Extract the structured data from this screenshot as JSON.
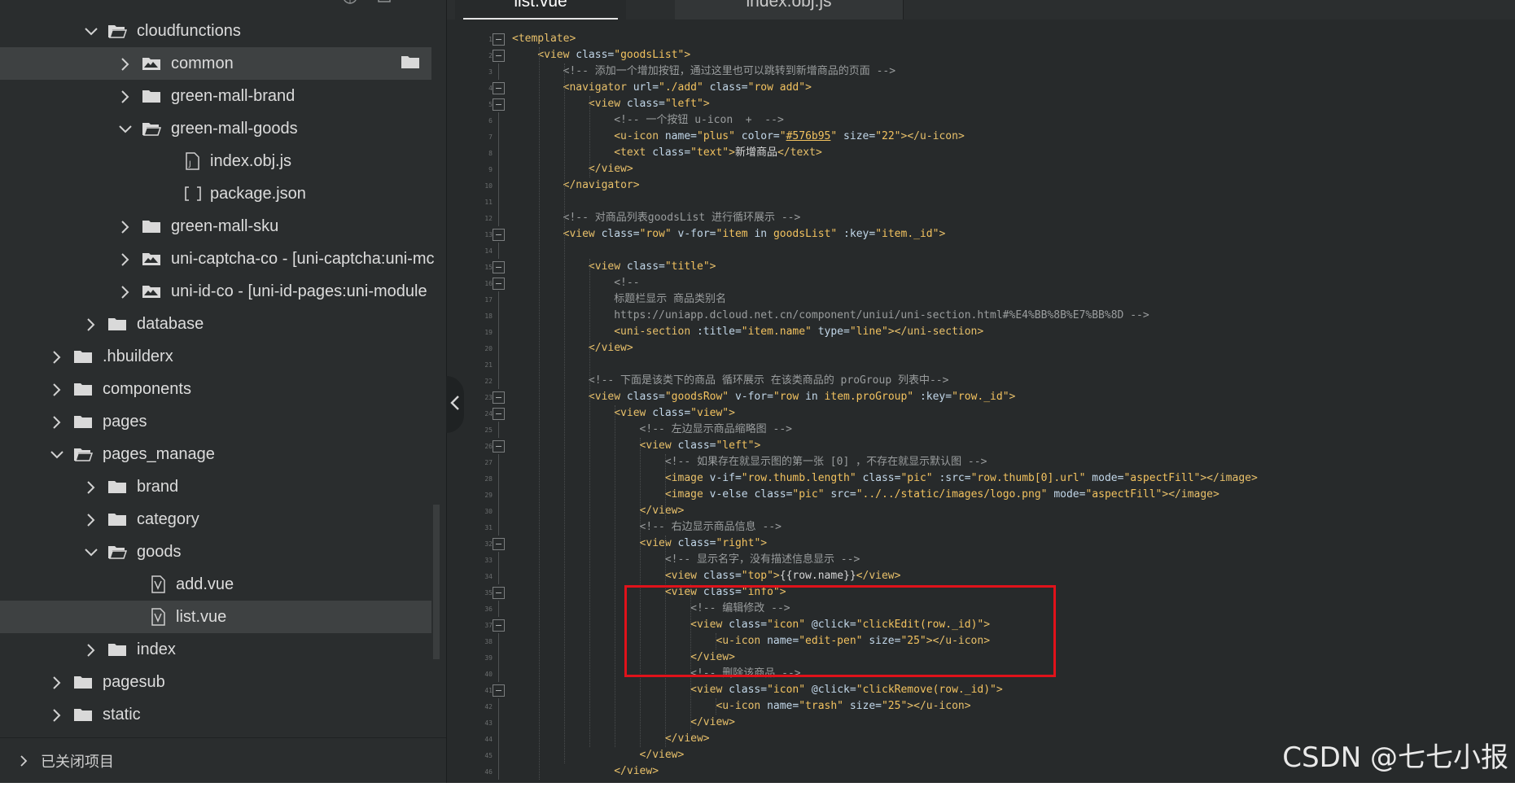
{
  "sidebar": {
    "items": [
      {
        "label": "cloudfunctions",
        "state": "open",
        "type": "folder-open"
      },
      {
        "label": "common",
        "state": "closed",
        "type": "folder-special",
        "selected": true
      },
      {
        "label": "green-mall-brand",
        "state": "closed",
        "type": "folder"
      },
      {
        "label": "green-mall-goods",
        "state": "open",
        "type": "folder-open"
      },
      {
        "label": "index.obj.js",
        "state": "none",
        "type": "js-file"
      },
      {
        "label": "package.json",
        "state": "none",
        "type": "json-file"
      },
      {
        "label": "green-mall-sku",
        "state": "closed",
        "type": "folder"
      },
      {
        "label": "uni-captcha-co - [uni-captcha:uni-mc",
        "state": "closed",
        "type": "folder-special"
      },
      {
        "label": "uni-id-co - [uni-id-pages:uni-module",
        "state": "closed",
        "type": "folder-special"
      },
      {
        "label": "database",
        "state": "closed",
        "type": "folder"
      },
      {
        "label": ".hbuilderx",
        "state": "closed",
        "type": "folder"
      },
      {
        "label": "components",
        "state": "closed",
        "type": "folder"
      },
      {
        "label": "pages",
        "state": "closed",
        "type": "folder"
      },
      {
        "label": "pages_manage",
        "state": "open",
        "type": "folder-open"
      },
      {
        "label": "brand",
        "state": "closed",
        "type": "folder"
      },
      {
        "label": "category",
        "state": "closed",
        "type": "folder"
      },
      {
        "label": "goods",
        "state": "open",
        "type": "folder-open"
      },
      {
        "label": "add.vue",
        "state": "none",
        "type": "vue-file"
      },
      {
        "label": "list.vue",
        "state": "none",
        "type": "vue-file",
        "selected": true
      },
      {
        "label": "index",
        "state": "closed",
        "type": "folder"
      },
      {
        "label": "pagesub",
        "state": "closed",
        "type": "folder"
      },
      {
        "label": "static",
        "state": "closed",
        "type": "folder"
      }
    ],
    "footer_label": "已关闭项目"
  },
  "tabs": [
    {
      "label": "list.vue",
      "active": true
    },
    {
      "label": "index.obj.js",
      "active": false
    }
  ],
  "editor": {
    "line_numbers": [
      "1",
      "2",
      "3",
      "4",
      "5",
      "6",
      "7",
      "8",
      "9",
      "10",
      "11",
      "12",
      "13",
      "14",
      "15",
      "16",
      "17",
      "18",
      "19",
      "20",
      "21",
      "22",
      "23",
      "24",
      "25",
      "26",
      "27",
      "28",
      "29",
      "30",
      "31",
      "32",
      "33",
      "34",
      "35",
      "36",
      "37",
      "38",
      "39",
      "40",
      "41",
      "42",
      "43",
      "44",
      "45",
      "46"
    ],
    "fold_lines": [
      1,
      2,
      4,
      5,
      13,
      15,
      16,
      23,
      24,
      26,
      32,
      35,
      37,
      41
    ],
    "lines": [
      [
        [
          "t",
          "<template>"
        ]
      ],
      [
        [
          "k",
          "    "
        ],
        [
          "t",
          "<view "
        ],
        [
          "a",
          "class="
        ],
        [
          "s",
          "\"goodsList\""
        ],
        [
          "t",
          ">"
        ]
      ],
      [
        [
          "k",
          "        "
        ],
        [
          "c",
          "<!-- 添加一个增加按钮，通过这里也可以跳转到新增商品的页面 -->"
        ]
      ],
      [
        [
          "k",
          "        "
        ],
        [
          "t",
          "<navigator "
        ],
        [
          "a",
          "url="
        ],
        [
          "s",
          "\"./add\" "
        ],
        [
          "a",
          "class="
        ],
        [
          "s",
          "\"row add\""
        ],
        [
          "t",
          ">"
        ]
      ],
      [
        [
          "k",
          "            "
        ],
        [
          "t",
          "<view "
        ],
        [
          "a",
          "class="
        ],
        [
          "s",
          "\"left\""
        ],
        [
          "t",
          ">"
        ]
      ],
      [
        [
          "k",
          "                "
        ],
        [
          "c",
          "<!-- 一个按钮 u-icon  +  -->"
        ]
      ],
      [
        [
          "k",
          "                "
        ],
        [
          "t",
          "<u-icon "
        ],
        [
          "a",
          "name="
        ],
        [
          "s",
          "\"plus\" "
        ],
        [
          "a",
          "color="
        ],
        [
          "s",
          "\""
        ],
        [
          "hex",
          "#576b95"
        ],
        [
          "s",
          "\" "
        ],
        [
          "a",
          "size="
        ],
        [
          "s",
          "\"22\""
        ],
        [
          "t",
          "></u-icon>"
        ]
      ],
      [
        [
          "k",
          "                "
        ],
        [
          "t",
          "<text "
        ],
        [
          "a",
          "class="
        ],
        [
          "s",
          "\"text\""
        ],
        [
          "t",
          ">"
        ],
        [
          "k",
          "新增商品"
        ],
        [
          "t",
          "</text>"
        ]
      ],
      [
        [
          "k",
          "            "
        ],
        [
          "t",
          "</view>"
        ]
      ],
      [
        [
          "k",
          "        "
        ],
        [
          "t",
          "</navigator>"
        ]
      ],
      [
        [
          "k",
          ""
        ]
      ],
      [
        [
          "k",
          "        "
        ],
        [
          "c",
          "<!-- 对商品列表goodsList 进行循环展示 -->"
        ]
      ],
      [
        [
          "k",
          "        "
        ],
        [
          "t",
          "<view "
        ],
        [
          "a",
          "class="
        ],
        [
          "s",
          "\"row\" "
        ],
        [
          "a",
          "v-for="
        ],
        [
          "s",
          "\"item "
        ],
        [
          "a",
          "in "
        ],
        [
          "s",
          "goodsList\" "
        ],
        [
          "a",
          ":key="
        ],
        [
          "s",
          "\"item._id\""
        ],
        [
          "t",
          ">"
        ]
      ],
      [
        [
          "k",
          ""
        ]
      ],
      [
        [
          "k",
          "            "
        ],
        [
          "t",
          "<view "
        ],
        [
          "a",
          "class="
        ],
        [
          "s",
          "\"title\""
        ],
        [
          "t",
          ">"
        ]
      ],
      [
        [
          "k",
          "                "
        ],
        [
          "c",
          "<!--"
        ]
      ],
      [
        [
          "k",
          "                "
        ],
        [
          "c",
          "标题栏显示 商品类别名"
        ]
      ],
      [
        [
          "k",
          "                "
        ],
        [
          "c",
          "https://uniapp.dcloud.net.cn/component/uniui/uni-section.html#%E4%BB%8B%E7%BB%8D -->"
        ]
      ],
      [
        [
          "k",
          "                "
        ],
        [
          "t",
          "<uni-section "
        ],
        [
          "a",
          ":title="
        ],
        [
          "s",
          "\"item.name\" "
        ],
        [
          "a",
          "type="
        ],
        [
          "s",
          "\"line\""
        ],
        [
          "t",
          "></uni-section>"
        ]
      ],
      [
        [
          "k",
          "            "
        ],
        [
          "t",
          "</view>"
        ]
      ],
      [
        [
          "k",
          ""
        ]
      ],
      [
        [
          "k",
          "            "
        ],
        [
          "c",
          "<!-- 下面是该类下的商品 循环展示 在该类商品的 proGroup 列表中-->"
        ]
      ],
      [
        [
          "k",
          "            "
        ],
        [
          "t",
          "<view "
        ],
        [
          "a",
          "class="
        ],
        [
          "s",
          "\"goodsRow\" "
        ],
        [
          "a",
          "v-for="
        ],
        [
          "s",
          "\"row "
        ],
        [
          "a",
          "in "
        ],
        [
          "s",
          "item.proGroup\" "
        ],
        [
          "a",
          ":key="
        ],
        [
          "s",
          "\"row._id\""
        ],
        [
          "t",
          ">"
        ]
      ],
      [
        [
          "k",
          "                "
        ],
        [
          "t",
          "<view "
        ],
        [
          "a",
          "class="
        ],
        [
          "s",
          "\"view\""
        ],
        [
          "t",
          ">"
        ]
      ],
      [
        [
          "k",
          "                    "
        ],
        [
          "c",
          "<!-- 左边显示商品缩略图 -->"
        ]
      ],
      [
        [
          "k",
          "                    "
        ],
        [
          "t",
          "<view "
        ],
        [
          "a",
          "class="
        ],
        [
          "s",
          "\"left\""
        ],
        [
          "t",
          ">"
        ]
      ],
      [
        [
          "k",
          "                        "
        ],
        [
          "c",
          "<!-- 如果存在就显示图的第一张 [0] ，不存在就显示默认图 -->"
        ]
      ],
      [
        [
          "k",
          "                        "
        ],
        [
          "t",
          "<image "
        ],
        [
          "a",
          "v-if="
        ],
        [
          "s",
          "\"row.thumb.length\" "
        ],
        [
          "a",
          "class="
        ],
        [
          "s",
          "\"pic\" "
        ],
        [
          "a",
          ":src="
        ],
        [
          "s",
          "\"row.thumb[0].url\" "
        ],
        [
          "a",
          "mode="
        ],
        [
          "s",
          "\"aspectFill\""
        ],
        [
          "t",
          "></image>"
        ]
      ],
      [
        [
          "k",
          "                        "
        ],
        [
          "t",
          "<image "
        ],
        [
          "a",
          "v-else "
        ],
        [
          "a",
          "class="
        ],
        [
          "s",
          "\"pic\" "
        ],
        [
          "a",
          "src="
        ],
        [
          "s",
          "\"../../static/images/logo.png\" "
        ],
        [
          "a",
          "mode="
        ],
        [
          "s",
          "\"aspectFill\""
        ],
        [
          "t",
          "></image>"
        ]
      ],
      [
        [
          "k",
          "                    "
        ],
        [
          "t",
          "</view>"
        ]
      ],
      [
        [
          "k",
          "                    "
        ],
        [
          "c",
          "<!-- 右边显示商品信息 -->"
        ]
      ],
      [
        [
          "k",
          "                    "
        ],
        [
          "t",
          "<view "
        ],
        [
          "a",
          "class="
        ],
        [
          "s",
          "\"right\""
        ],
        [
          "t",
          ">"
        ]
      ],
      [
        [
          "k",
          "                        "
        ],
        [
          "c",
          "<!-- 显示名字，没有描述信息显示 -->"
        ]
      ],
      [
        [
          "k",
          "                        "
        ],
        [
          "t",
          "<view "
        ],
        [
          "a",
          "class="
        ],
        [
          "s",
          "\"top\""
        ],
        [
          "t",
          ">"
        ],
        [
          "k",
          "{{row.name}}"
        ],
        [
          "t",
          "</view>"
        ]
      ],
      [
        [
          "k",
          "                        "
        ],
        [
          "t",
          "<view "
        ],
        [
          "a",
          "class="
        ],
        [
          "s",
          "\"info\""
        ],
        [
          "t",
          ">"
        ]
      ],
      [
        [
          "k",
          "                            "
        ],
        [
          "c",
          "<!-- 编辑修改 -->"
        ]
      ],
      [
        [
          "k",
          "                            "
        ],
        [
          "t",
          "<view "
        ],
        [
          "a",
          "class="
        ],
        [
          "s",
          "\"icon\" "
        ],
        [
          "a",
          "@click="
        ],
        [
          "s",
          "\"clickEdit(row._id)\""
        ],
        [
          "t",
          ">"
        ]
      ],
      [
        [
          "k",
          "                                "
        ],
        [
          "t",
          "<u-icon "
        ],
        [
          "a",
          "name="
        ],
        [
          "s",
          "\"edit-pen\" "
        ],
        [
          "a",
          "size="
        ],
        [
          "s",
          "\"25\""
        ],
        [
          "t",
          "></u-icon>"
        ]
      ],
      [
        [
          "k",
          "                            "
        ],
        [
          "t",
          "</view>"
        ]
      ],
      [
        [
          "k",
          "                            "
        ],
        [
          "c",
          "<!-- 删除该商品 -->"
        ]
      ],
      [
        [
          "k",
          "                            "
        ],
        [
          "t",
          "<view "
        ],
        [
          "a",
          "class="
        ],
        [
          "s",
          "\"icon\" "
        ],
        [
          "a",
          "@click="
        ],
        [
          "s",
          "\"clickRemove(row._id)\""
        ],
        [
          "t",
          ">"
        ]
      ],
      [
        [
          "k",
          "                                "
        ],
        [
          "t",
          "<u-icon "
        ],
        [
          "a",
          "name="
        ],
        [
          "s",
          "\"trash\" "
        ],
        [
          "a",
          "size="
        ],
        [
          "s",
          "\"25\""
        ],
        [
          "t",
          "></u-icon>"
        ]
      ],
      [
        [
          "k",
          "                            "
        ],
        [
          "t",
          "</view>"
        ]
      ],
      [
        [
          "k",
          "                        "
        ],
        [
          "t",
          "</view>"
        ]
      ],
      [
        [
          "k",
          "                    "
        ],
        [
          "t",
          "</view>"
        ]
      ],
      [
        [
          "k",
          "                "
        ],
        [
          "t",
          "</view>"
        ]
      ]
    ]
  },
  "watermark": "CSDN @七七小报",
  "colors": {
    "sidebar_bg": "#2a2d2e",
    "editor_bg": "#272a2b",
    "highlight_border": "#e0121a",
    "tag": "#e8c06a",
    "string": "#f2c25f",
    "comment": "#9a9d9e"
  },
  "icons": {
    "collapse": "chevron-left-icon",
    "expanded": "chevron-down-icon",
    "collapsed": "chevron-right-icon",
    "folder": "folder-icon"
  }
}
